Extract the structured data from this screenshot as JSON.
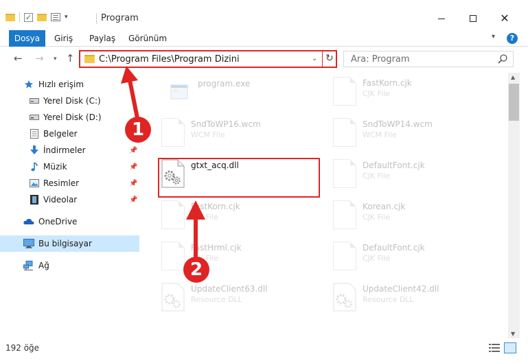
{
  "window": {
    "title": "Program",
    "controls": {
      "minimize": "minimize",
      "maximize": "maximize",
      "close": "close"
    }
  },
  "ribbon": {
    "tabs": [
      {
        "label": "Dosya",
        "active": true
      },
      {
        "label": "Giriş"
      },
      {
        "label": "Paylaş"
      },
      {
        "label": "Görünüm"
      }
    ],
    "help": "?"
  },
  "address_bar": {
    "path": "C:\\Program Files\\Program Dizini",
    "search_placeholder": "Ara: Program"
  },
  "navigation_pane": {
    "items": [
      {
        "label": "Hızlı erişim",
        "icon": "star-icon",
        "level": "top"
      },
      {
        "label": "Yerel Disk (C:)",
        "icon": "drive-icon",
        "level": "sub"
      },
      {
        "label": "Yerel Disk (D:)",
        "icon": "drive-icon",
        "level": "sub"
      },
      {
        "label": "Belgeler",
        "icon": "documents-icon",
        "level": "sub"
      },
      {
        "label": "İndirmeler",
        "icon": "download-icon",
        "level": "sub",
        "pinned": true
      },
      {
        "label": "Müzik",
        "icon": "music-icon",
        "level": "sub",
        "pinned": true
      },
      {
        "label": "Resimler",
        "icon": "pictures-icon",
        "level": "sub",
        "pinned": true
      },
      {
        "label": "Videolar",
        "icon": "videos-icon",
        "level": "sub",
        "pinned": true
      },
      {
        "label": "OneDrive",
        "icon": "cloud-icon",
        "level": "top"
      },
      {
        "label": "Bu bilgisayar",
        "icon": "computer-icon",
        "level": "top",
        "selected": true
      },
      {
        "label": "Ağ",
        "icon": "network-icon",
        "level": "top"
      }
    ]
  },
  "files": [
    {
      "name": "program.exe",
      "type": "",
      "icon": "exe-icon",
      "faded": true
    },
    {
      "name": "FastKorn.cjk",
      "type": "CJK File",
      "icon": "file-icon",
      "faded": true
    },
    {
      "name": "SndToWP16.wcm",
      "type": "WCM File",
      "icon": "file-icon",
      "faded": true
    },
    {
      "name": "SndToWP14.wcm",
      "type": "WCM File",
      "icon": "file-icon",
      "faded": true
    },
    {
      "name": "gtxt_acq.dll",
      "type": "",
      "icon": "dll-gear-icon",
      "faded": false,
      "highlighted": true
    },
    {
      "name": "DefaultFont.cjk",
      "type": "CJK File",
      "icon": "file-icon",
      "faded": true
    },
    {
      "name": "FastKorn.cjk",
      "type": "CJK File",
      "icon": "file-icon",
      "faded": true
    },
    {
      "name": "Korean.cjk",
      "type": "CJK File",
      "icon": "file-icon",
      "faded": true
    },
    {
      "name": "FastHrml.cjk",
      "type": "CJK File",
      "icon": "file-icon",
      "faded": true
    },
    {
      "name": "DefaultFont.cjk",
      "type": "CJK File",
      "icon": "file-icon",
      "faded": true
    },
    {
      "name": "UpdateClient63.dll",
      "type": "Resource DLL",
      "icon": "dll-gear-icon",
      "faded": true
    },
    {
      "name": "UpdateClient42.dll",
      "type": "Resource DLL",
      "icon": "dll-gear-icon",
      "faded": true
    }
  ],
  "status": {
    "item_count": "192 öğe"
  },
  "annotations": {
    "marker_1": "1",
    "marker_2": "2",
    "color": "#e02424"
  },
  "colors": {
    "accent": "#1979ca",
    "selection": "#cce8ff",
    "annotation": "#e02424"
  }
}
